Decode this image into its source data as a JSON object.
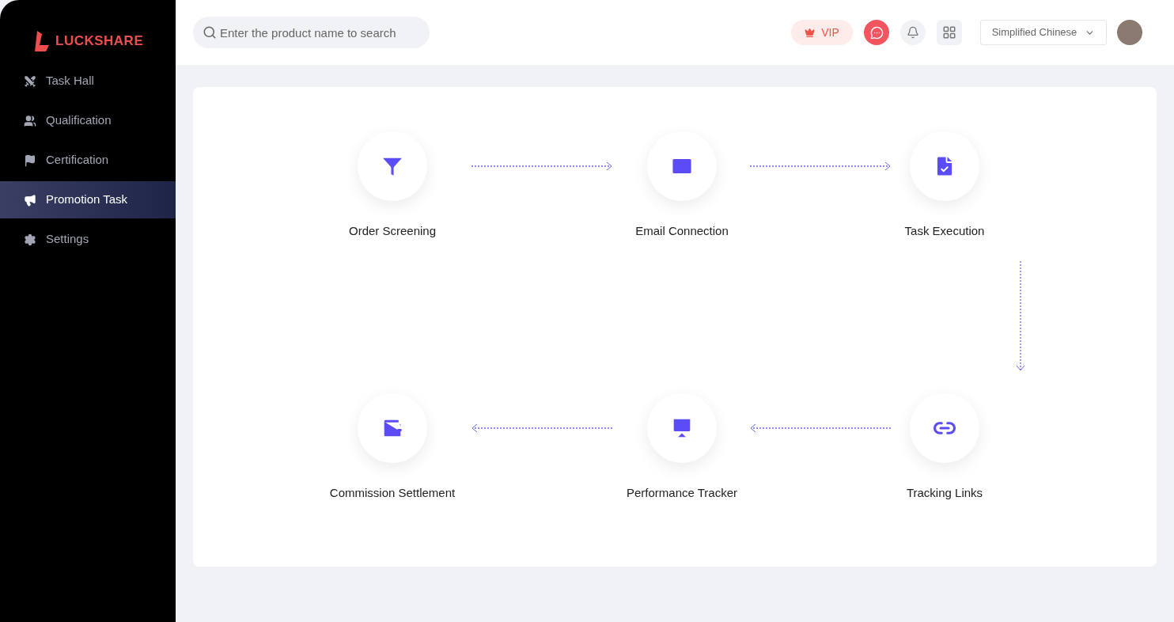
{
  "logo": {
    "text": "LUCKSHARE"
  },
  "sidebar": {
    "items": [
      {
        "label": "Task Hall",
        "selected": false
      },
      {
        "label": "Qualification",
        "selected": false
      },
      {
        "label": "Certification",
        "selected": false
      },
      {
        "label": "Promotion Task",
        "selected": true
      },
      {
        "label": "Settings",
        "selected": false
      }
    ]
  },
  "header": {
    "search": {
      "placeholder": "Enter the product name to search"
    },
    "vip": "VIP",
    "language": "Simplified Chinese"
  },
  "flow": {
    "steps": [
      {
        "label": "Order Screening"
      },
      {
        "label": "Email Connection"
      },
      {
        "label": "Task Execution"
      },
      {
        "label": "Commission Settlement"
      },
      {
        "label": "Performance Tracker"
      },
      {
        "label": "Tracking Links"
      }
    ]
  }
}
